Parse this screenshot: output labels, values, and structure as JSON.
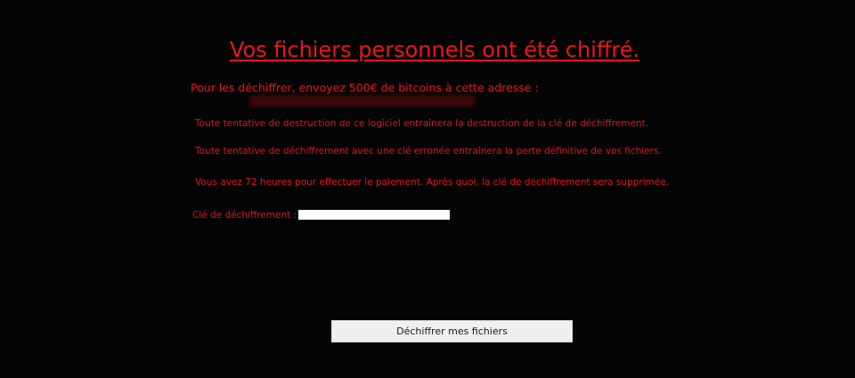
{
  "title": "Vos fichiers personnels ont été chiffré.",
  "payment_instruction": "Pour les déchiffrer, envoyez 500€ de bitcoins à cette adresse :",
  "bitcoin_address": "",
  "warnings": [
    "Toute tentative de destruction de ce logiciel entraînera la destruction de la clé de déchiffrement.",
    "Toute tentative de déchiffrement avec une clé erronée entraînera la perte définitive de vos fichiers.",
    "Vous avez 72 heures pour effectuer le paiement. Après quoi, la clé de déchiffrement sera supprimée."
  ],
  "key_field": {
    "label": "Clé de déchiffrement :",
    "value": ""
  },
  "decrypt_button": {
    "label": "Déchiffrer mes fichiers"
  },
  "colors": {
    "background": "#050505",
    "text_red": "#e8161c",
    "button_bg": "#efefef"
  }
}
